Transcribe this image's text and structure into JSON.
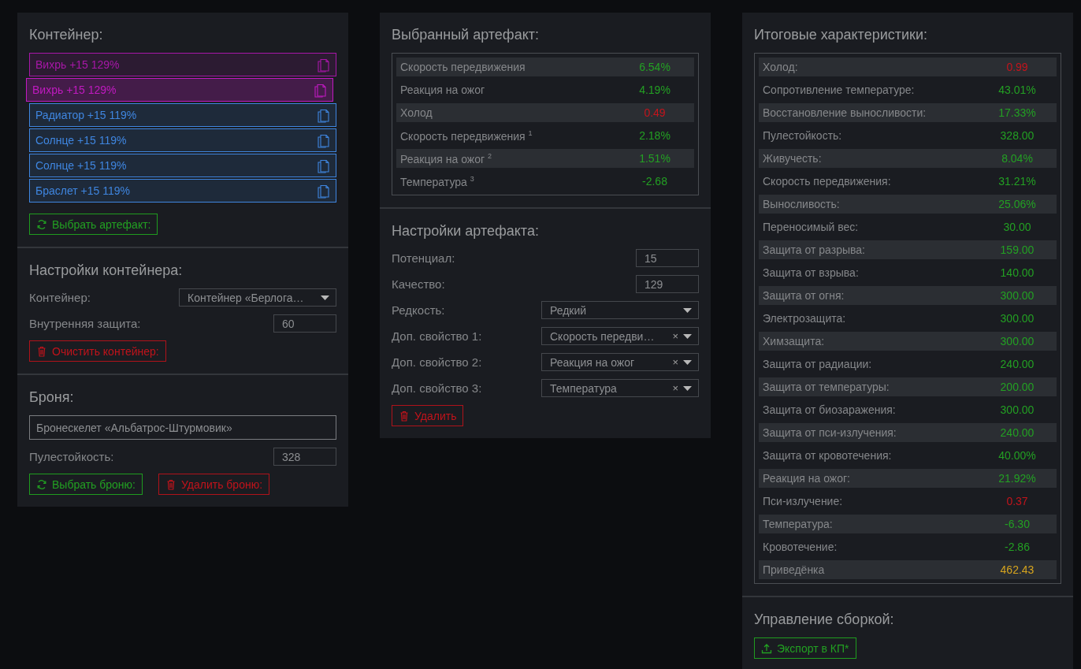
{
  "container": {
    "title": "Контейнер:",
    "artifacts": [
      {
        "label": "Вихрь +15 129%",
        "color": "#a817a8",
        "selected": false
      },
      {
        "label": "Вихрь +15 129%",
        "color": "#a817a8",
        "selected": true
      },
      {
        "label": "Радиатор +15 119%",
        "color": "#3f86e0",
        "selected": false
      },
      {
        "label": "Солнце +15 119%",
        "color": "#3f86e0",
        "selected": false
      },
      {
        "label": "Солнце +15 119%",
        "color": "#3f86e0",
        "selected": false
      },
      {
        "label": "Браслет +15 119%",
        "color": "#3f86e0",
        "selected": false
      }
    ],
    "pick_button": "Выбрать артефакт:"
  },
  "container_settings": {
    "title": "Настройки контейнера:",
    "fields": [
      {
        "kind": "select",
        "label": "Контейнер:",
        "value": "Контейнер «Берлога…"
      },
      {
        "kind": "input",
        "label": "Внутренняя защита:",
        "value": "60"
      }
    ],
    "clear_button": "Очистить контейнер:"
  },
  "armor": {
    "title": "Броня:",
    "name": "Бронескелет «Альбатрос-Штурмовик»",
    "fields": [
      {
        "kind": "input",
        "label": "Пулестойкость:",
        "value": "328"
      }
    ],
    "pick_button": "Выбрать броню:",
    "delete_button": "Удалить броню:"
  },
  "selected_artifact": {
    "title": "Выбранный артефакт:",
    "stats": [
      {
        "label": "Скорость передвижения",
        "value": "6.54%",
        "color": "#23a023"
      },
      {
        "label": "Реакция на ожог",
        "value": "4.19%",
        "color": "#23a023"
      },
      {
        "label": "Холод",
        "value": "0.49",
        "color": "#c4141c"
      },
      {
        "label": "Скорость передвижения $^{1}$",
        "value": "2.18%",
        "color": "#23a023"
      },
      {
        "label": "Реакция на ожог $^{2}$",
        "value": "1.51%",
        "color": "#23a023"
      },
      {
        "label": "Температура $^{3}$",
        "value": "-2.68",
        "color": "#23a023"
      }
    ]
  },
  "artifact_settings": {
    "title": "Настройки артефакта:",
    "fields": [
      {
        "kind": "input",
        "label": "Потенциал:",
        "value": "15"
      },
      {
        "kind": "input",
        "label": "Качество:",
        "value": "129"
      },
      {
        "kind": "select",
        "label": "Редкость:",
        "value": "Редкий"
      },
      {
        "kind": "select",
        "label": "Доп. свойство 1:",
        "value": "Скорость передви…",
        "clear": "×"
      },
      {
        "kind": "select",
        "label": "Доп. свойство 2:",
        "value": "Реакция на ожог",
        "clear": "×"
      },
      {
        "kind": "select",
        "label": "Доп. свойство 3:",
        "value": "Температура",
        "clear": "×"
      }
    ],
    "delete_button": "Удалить"
  },
  "totals": {
    "title": "Итоговые характеристики:",
    "stats": [
      {
        "label": "Холод:",
        "value": "0.99",
        "color": "#c4141c"
      },
      {
        "label": "Сопротивление температуре:",
        "value": "43.01%",
        "color": "#23a023"
      },
      {
        "label": "Восстановление выносливости:",
        "value": "17.33%",
        "color": "#23a023"
      },
      {
        "label": "Пулестойкость:",
        "value": "328.00",
        "color": "#23a023"
      },
      {
        "label": "Живучесть:",
        "value": "8.04%",
        "color": "#23a023"
      },
      {
        "label": "Скорость передвижения:",
        "value": "31.21%",
        "color": "#23a023"
      },
      {
        "label": "Выносливость:",
        "value": "25.06%",
        "color": "#23a023"
      },
      {
        "label": "Переносимый вес:",
        "value": "30.00",
        "color": "#23a023"
      },
      {
        "label": "Защита от разрыва:",
        "value": "159.00",
        "color": "#23a023"
      },
      {
        "label": "Защита от взрыва:",
        "value": "140.00",
        "color": "#23a023"
      },
      {
        "label": "Защита от огня:",
        "value": "300.00",
        "color": "#23a023"
      },
      {
        "label": "Электрозащита:",
        "value": "300.00",
        "color": "#23a023"
      },
      {
        "label": "Химзащита:",
        "value": "300.00",
        "color": "#23a023"
      },
      {
        "label": "Защита от радиации:",
        "value": "240.00",
        "color": "#23a023"
      },
      {
        "label": "Защита от температуры:",
        "value": "200.00",
        "color": "#23a023"
      },
      {
        "label": "Защита от биозаражения:",
        "value": "300.00",
        "color": "#23a023"
      },
      {
        "label": "Защита от пси-излучения:",
        "value": "240.00",
        "color": "#23a023"
      },
      {
        "label": "Защита от кровотечения:",
        "value": "40.00%",
        "color": "#23a023"
      },
      {
        "label": "Реакция на ожог:",
        "value": "21.92%",
        "color": "#23a023"
      },
      {
        "label": "Пси-излучение:",
        "value": "0.37",
        "color": "#c4141c"
      },
      {
        "label": "Температура:",
        "value": "-6.30",
        "color": "#23a023"
      },
      {
        "label": "Кровотечение:",
        "value": "-2.86",
        "color": "#23a023"
      },
      {
        "label": "Приведёнка",
        "value": "462.43",
        "color": "#d6a41e"
      }
    ]
  },
  "build": {
    "title": "Управление сборкой:",
    "export_button": "Экспорт в КП*"
  }
}
